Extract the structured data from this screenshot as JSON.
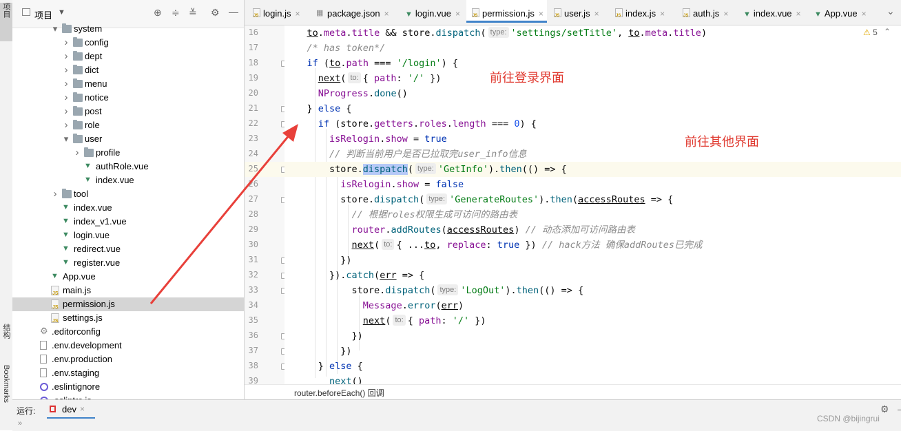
{
  "left_strip": {
    "project_tab": "项目",
    "structure_tab": "结构",
    "bookmarks_tab": "Bookmarks"
  },
  "project_panel": {
    "title": "项目",
    "icons": [
      "target-icon",
      "expand-all-icon",
      "collapse-all-icon",
      "gear-icon",
      "minimize-icon"
    ],
    "tree": [
      {
        "label": "system",
        "kind": "folder",
        "depth": 4,
        "expanded": true
      },
      {
        "label": "config",
        "kind": "folder",
        "depth": 5,
        "expanded": false
      },
      {
        "label": "dept",
        "kind": "folder",
        "depth": 5,
        "expanded": false
      },
      {
        "label": "dict",
        "kind": "folder",
        "depth": 5,
        "expanded": false
      },
      {
        "label": "menu",
        "kind": "folder",
        "depth": 5,
        "expanded": false
      },
      {
        "label": "notice",
        "kind": "folder",
        "depth": 5,
        "expanded": false
      },
      {
        "label": "post",
        "kind": "folder",
        "depth": 5,
        "expanded": false
      },
      {
        "label": "role",
        "kind": "folder",
        "depth": 5,
        "expanded": false
      },
      {
        "label": "user",
        "kind": "folder",
        "depth": 5,
        "expanded": true
      },
      {
        "label": "profile",
        "kind": "folder",
        "depth": 6,
        "expanded": false
      },
      {
        "label": "authRole.vue",
        "kind": "vue",
        "depth": 6
      },
      {
        "label": "index.vue",
        "kind": "vue",
        "depth": 6
      },
      {
        "label": "tool",
        "kind": "folder",
        "depth": 4,
        "expanded": false
      },
      {
        "label": "index.vue",
        "kind": "vue",
        "depth": 4
      },
      {
        "label": "index_v1.vue",
        "kind": "vue",
        "depth": 4
      },
      {
        "label": "login.vue",
        "kind": "vue",
        "depth": 4
      },
      {
        "label": "redirect.vue",
        "kind": "vue",
        "depth": 4
      },
      {
        "label": "register.vue",
        "kind": "vue",
        "depth": 4
      },
      {
        "label": "App.vue",
        "kind": "vue",
        "depth": 3
      },
      {
        "label": "main.js",
        "kind": "js",
        "depth": 3
      },
      {
        "label": "permission.js",
        "kind": "js",
        "depth": 3,
        "selected": true
      },
      {
        "label": "settings.js",
        "kind": "js",
        "depth": 3
      },
      {
        "label": ".editorconfig",
        "kind": "gear",
        "depth": 2
      },
      {
        "label": ".env.development",
        "kind": "txt",
        "depth": 2
      },
      {
        "label": ".env.production",
        "kind": "txt",
        "depth": 2
      },
      {
        "label": ".env.staging",
        "kind": "txt",
        "depth": 2
      },
      {
        "label": ".eslintignore",
        "kind": "eslint",
        "depth": 2
      },
      {
        "label": ".eslintrc.js",
        "kind": "eslint",
        "depth": 2
      }
    ]
  },
  "tabs": [
    {
      "label": "login.js",
      "kind": "js",
      "active": false
    },
    {
      "label": "package.json",
      "kind": "json",
      "active": false
    },
    {
      "label": "login.vue",
      "kind": "vue",
      "active": false
    },
    {
      "label": "permission.js",
      "kind": "js",
      "active": true
    },
    {
      "label": "user.js",
      "kind": "js",
      "active": false
    },
    {
      "label": "index.js",
      "kind": "js",
      "active": false
    },
    {
      "label": "auth.js",
      "kind": "js",
      "active": false
    },
    {
      "label": "index.vue",
      "kind": "vue",
      "active": false
    },
    {
      "label": "App.vue",
      "kind": "vue",
      "active": false
    }
  ],
  "tab_close_glyph": "×",
  "tabs_more_glyph": "⌄",
  "editor": {
    "warnings_count": "5",
    "current_line": "25",
    "line_numbers": [
      "16",
      "17",
      "18",
      "19",
      "20",
      "21",
      "22",
      "23",
      "24",
      "25",
      "26",
      "27",
      "28",
      "29",
      "30",
      "31",
      "32",
      "33",
      "34",
      "35",
      "36",
      "37",
      "38",
      "39"
    ],
    "annotation_login": "前往登录界面",
    "annotation_other": "前往其他界面"
  },
  "breadcrumb": "router.beforeEach() 回调",
  "run_bar": {
    "label": "运行:",
    "tab": "dev",
    "close": "×",
    "watermark": "CSDN @bijingrui",
    "expand_glyph": "»"
  },
  "colors": {
    "keyword": "#0033b3",
    "string": "#067d17",
    "property": "#871094",
    "function": "#00627a",
    "number": "#1750eb",
    "comment": "#8c8c8c",
    "annotation": "#e03a30",
    "active_tab_accent": "#4083c9",
    "selection": "#d5d5d5"
  }
}
